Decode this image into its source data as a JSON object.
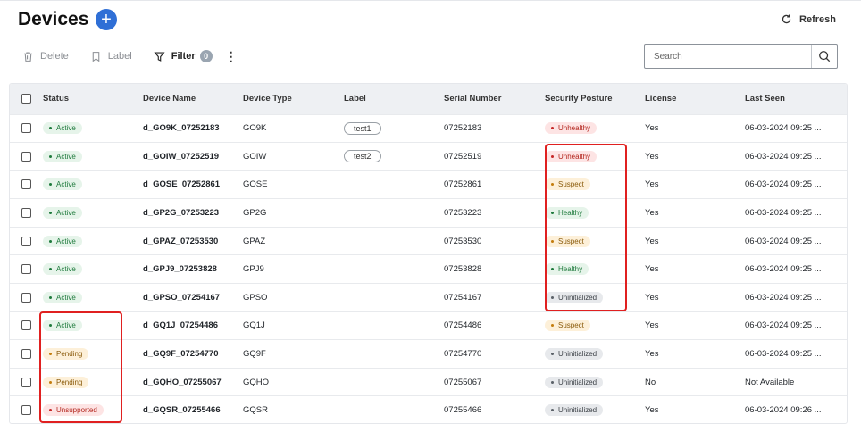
{
  "header": {
    "title": "Devices",
    "add_symbol": "+",
    "refresh_label": "Refresh"
  },
  "toolbar": {
    "delete_label": "Delete",
    "label_label": "Label",
    "filter_label": "Filter",
    "filter_count": "0",
    "more_symbol": "⋮"
  },
  "search": {
    "placeholder": "Search"
  },
  "table": {
    "columns": [
      "Status",
      "Device Name",
      "Device Type",
      "Label",
      "Serial Number",
      "Security Posture",
      "License",
      "Last Seen"
    ],
    "rows": [
      {
        "status": "Active",
        "status_color": "green",
        "name": "d_GO9K_07252183",
        "type": "GO9K",
        "label": "test1",
        "serial": "07252183",
        "posture": "Unhealthy",
        "posture_color": "red",
        "license": "Yes",
        "last_seen": "06-03-2024 09:25 ..."
      },
      {
        "status": "Active",
        "status_color": "green",
        "name": "d_GOIW_07252519",
        "type": "GOIW",
        "label": "test2",
        "serial": "07252519",
        "posture": "Unhealthy",
        "posture_color": "red",
        "license": "Yes",
        "last_seen": "06-03-2024 09:25 ..."
      },
      {
        "status": "Active",
        "status_color": "green",
        "name": "d_GOSE_07252861",
        "type": "GOSE",
        "label": "",
        "serial": "07252861",
        "posture": "Suspect",
        "posture_color": "orange",
        "license": "Yes",
        "last_seen": "06-03-2024 09:25 ..."
      },
      {
        "status": "Active",
        "status_color": "green",
        "name": "d_GP2G_07253223",
        "type": "GP2G",
        "label": "",
        "serial": "07253223",
        "posture": "Healthy",
        "posture_color": "green",
        "license": "Yes",
        "last_seen": "06-03-2024 09:25 ..."
      },
      {
        "status": "Active",
        "status_color": "green",
        "name": "d_GPAZ_07253530",
        "type": "GPAZ",
        "label": "",
        "serial": "07253530",
        "posture": "Suspect",
        "posture_color": "orange",
        "license": "Yes",
        "last_seen": "06-03-2024 09:25 ..."
      },
      {
        "status": "Active",
        "status_color": "green",
        "name": "d_GPJ9_07253828",
        "type": "GPJ9",
        "label": "",
        "serial": "07253828",
        "posture": "Healthy",
        "posture_color": "green",
        "license": "Yes",
        "last_seen": "06-03-2024 09:25 ..."
      },
      {
        "status": "Active",
        "status_color": "green",
        "name": "d_GPSO_07254167",
        "type": "GPSO",
        "label": "",
        "serial": "07254167",
        "posture": "Uninitialized",
        "posture_color": "gray",
        "license": "Yes",
        "last_seen": "06-03-2024 09:25 ..."
      },
      {
        "status": "Active",
        "status_color": "green",
        "name": "d_GQ1J_07254486",
        "type": "GQ1J",
        "label": "",
        "serial": "07254486",
        "posture": "Suspect",
        "posture_color": "orange",
        "license": "Yes",
        "last_seen": "06-03-2024 09:25 ..."
      },
      {
        "status": "Pending",
        "status_color": "orange",
        "name": "d_GQ9F_07254770",
        "type": "GQ9F",
        "label": "",
        "serial": "07254770",
        "posture": "Uninitialized",
        "posture_color": "gray",
        "license": "Yes",
        "last_seen": "06-03-2024 09:25 ..."
      },
      {
        "status": "Pending",
        "status_color": "orange",
        "name": "d_GQHO_07255067",
        "type": "GQHO",
        "label": "",
        "serial": "07255067",
        "posture": "Uninitialized",
        "posture_color": "gray",
        "license": "No",
        "last_seen": "Not Available"
      },
      {
        "status": "Unsupported",
        "status_color": "red",
        "name": "d_GQSR_07255466",
        "type": "GQSR",
        "label": "",
        "serial": "07255466",
        "posture": "Uninitialized",
        "posture_color": "gray",
        "license": "Yes",
        "last_seen": "06-03-2024 09:26 ..."
      }
    ]
  },
  "colors": {
    "accent": "#2f6fd6",
    "highlight_box": "#e02020"
  },
  "icons": [
    "plus-icon",
    "refresh-icon",
    "trash-icon",
    "bookmark-icon",
    "filter-icon",
    "kebab-icon",
    "search-icon",
    "checkbox-icon",
    "status-dot-icon"
  ]
}
